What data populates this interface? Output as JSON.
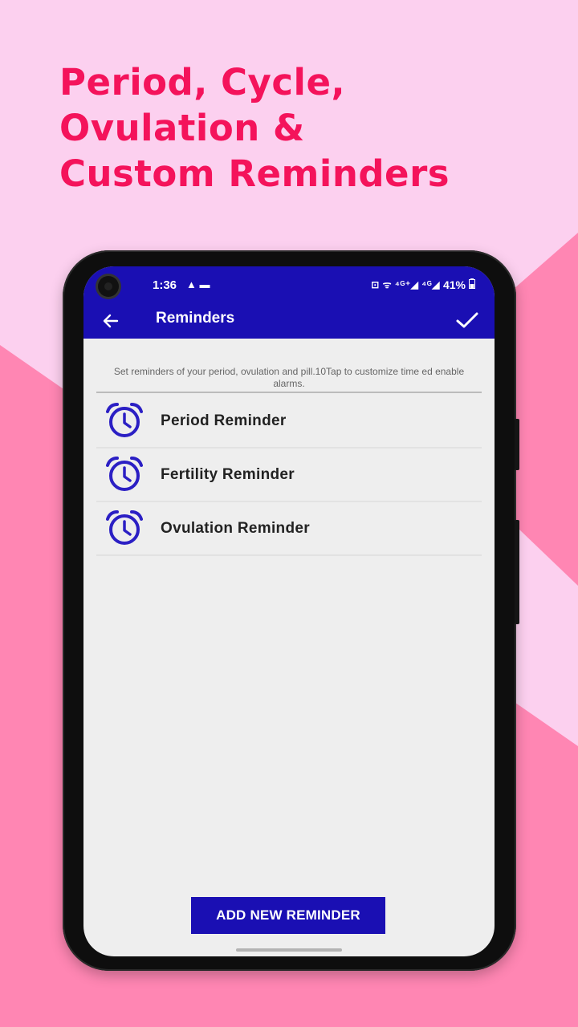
{
  "headline": {
    "line1": "Period, Cycle,",
    "line2": "Ovulation &",
    "line3": "Custom Reminders"
  },
  "status_bar": {
    "time": "1:36",
    "left_icons": "▲ ▬",
    "right_icons": "⊡ ᯤ ⁴ᴳ⁺◢ ⁴ᴳ◢",
    "battery": "41%"
  },
  "app_bar": {
    "title": "Reminders",
    "back_icon": "arrow-left-icon",
    "confirm_icon": "check-icon"
  },
  "hint_text": "Set reminders of your period, ovulation and pill.10Tap to customize time ed enable alarms.",
  "reminders": [
    {
      "label": "Period Reminder",
      "icon": "alarm-clock-icon"
    },
    {
      "label": "Fertility Reminder",
      "icon": "alarm-clock-icon"
    },
    {
      "label": "Ovulation Reminder",
      "icon": "alarm-clock-icon"
    }
  ],
  "add_button_label": "ADD NEW REMINDER",
  "colors": {
    "background": "#fcd0ef",
    "background_shapes": "#ff86b3",
    "headline": "#f4135b",
    "primary": "#1a0fb3",
    "screen": "#eeeeee"
  }
}
